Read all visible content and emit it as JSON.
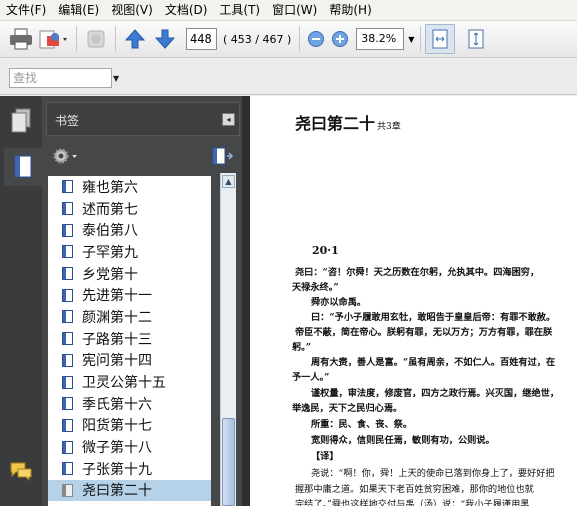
{
  "menu": [
    "文件(F)",
    "编辑(E)",
    "视图(V)",
    "文档(D)",
    "工具(T)",
    "窗口(W)",
    "帮助(H)"
  ],
  "toolbar": {
    "page_number": "448",
    "page_count": "( 453 / 467 )",
    "zoom": "38.2%",
    "icons": [
      "print-icon",
      "email-icon",
      "hand-icon",
      "previous-page-icon",
      "next-page-icon",
      "zoom-out-icon",
      "zoom-in-icon",
      "fit-page-icon",
      "fit-width-icon"
    ]
  },
  "search": {
    "placeholder": "查找"
  },
  "panel": {
    "title": "书签",
    "bookmarks": [
      "雍也第六",
      "述而第七",
      "泰伯第八",
      "子罕第九",
      "乡党第十",
      "先进第十一",
      "颜渊第十二",
      "子路第十三",
      "宪问第十四",
      "卫灵公第十五",
      "季氏第十六",
      "阳货第十七",
      "微子第十八",
      "子张第十九",
      "尧曰第二十"
    ],
    "selected_index": 14
  },
  "document": {
    "chapter": "尧曰第二十",
    "chapter_note": "共3章",
    "section": "20·1",
    "lines": [
      "尧曰：“咨！尔舜！天之历数在尔躬，允执其中。四海困穷，",
      "天禄永终。”",
      "舜亦以命禹。",
      "曰：“予小子履敢用玄牡，敢昭告于皇皇后帝：有罪不敢赦。",
      "帝臣不蔽，简在帝心。朕躬有罪，无以万方；万方有罪，罪在朕",
      "躬。”",
      "周有大赉，善人是富。“虽有周亲，不如仁人。百姓有过，在",
      "予一人。”",
      "谨权量，审法度，修废官，四方之政行焉。兴灭国，继绝世，",
      "举逸民，天下之民归心焉。",
      "所重：民、食、丧、祭。",
      "宽则得众，信则民任焉，敏则有功，公则说。",
      "【译】",
      "尧说：“啊！你，舜！上天的使命已落到你身上了，要好好把",
      "握那中庸之道。如果天下老百姓贫穷困难，那你的地位也就",
      "完结了。”舜也这样地交付与禹（汤）说：“我小子履谨用黑"
    ]
  }
}
